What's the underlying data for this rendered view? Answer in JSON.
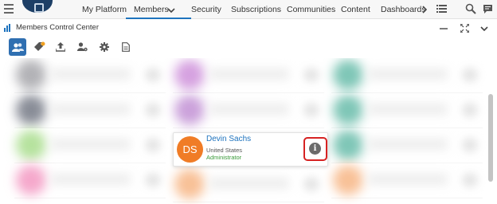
{
  "topnav": {
    "items": [
      {
        "label": "My Platform"
      },
      {
        "label": "Members"
      },
      {
        "label": "Security"
      },
      {
        "label": "Subscriptions"
      },
      {
        "label": "Communities"
      },
      {
        "label": "Content"
      },
      {
        "label": "Dashboards"
      }
    ],
    "active_index": 1,
    "icons": [
      "hamburger-icon",
      "logo",
      "chevron-down-icon",
      "chevron-right-icon",
      "list-icon",
      "search-user-icon",
      "chat-icon"
    ]
  },
  "widget": {
    "title": "Members Control Center",
    "controls": [
      "minimize-icon",
      "expand-icon",
      "collapse-icon"
    ]
  },
  "toolbar": {
    "buttons": [
      "members-icon",
      "tag-icon",
      "upload-icon",
      "user-settings-icon",
      "gear-icon",
      "document-icon"
    ],
    "active_index": 0
  },
  "member_card": {
    "initials": "DS",
    "name": "Devin Sachs",
    "country": "United States",
    "role": "Administrator",
    "avatar_color": "#f07c26",
    "action_icon": "info-icon"
  },
  "colors": {
    "accent": "#1e73be",
    "highlight": "#d62222",
    "role": "#3a9a3a"
  }
}
